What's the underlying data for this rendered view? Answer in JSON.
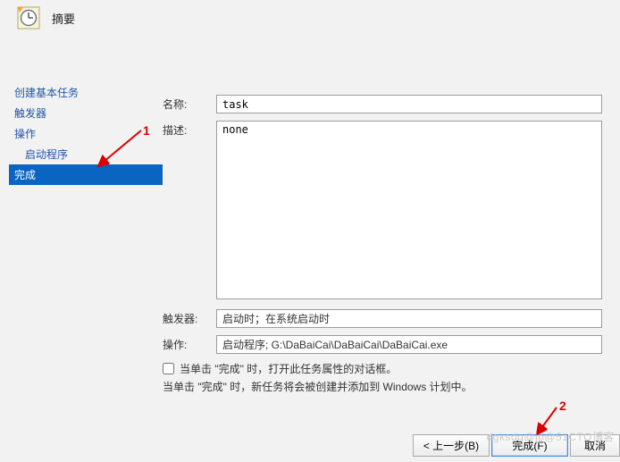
{
  "header": {
    "title": "摘要"
  },
  "sidebar": {
    "items": [
      {
        "label": "创建基本任务"
      },
      {
        "label": "触发器"
      },
      {
        "label": "操作"
      },
      {
        "label": "启动程序"
      },
      {
        "label": "完成"
      }
    ]
  },
  "form": {
    "name_label": "名称:",
    "name_value": "task",
    "desc_label": "描述:",
    "desc_value": "none",
    "trigger_label": "触发器:",
    "trigger_value": "启动时；在系统启动时",
    "action_label": "操作:",
    "action_value": "启动程序; G:\\DaBaiCai\\DaBaiCai\\DaBaiCai.exe",
    "open_props_label": "当单击 \"完成\" 时，打开此任务属性的对话框。",
    "note": "当单击 \"完成\" 时，新任务将会被创建并添加到 Windows 计划中。"
  },
  "buttons": {
    "back": "< 上一步(B)",
    "finish": "完成(F)",
    "cancel": "取消"
  },
  "annotations": {
    "mark1": "1",
    "mark2": "2"
  },
  "watermark": "dgksdq@jp@51CTO博客"
}
